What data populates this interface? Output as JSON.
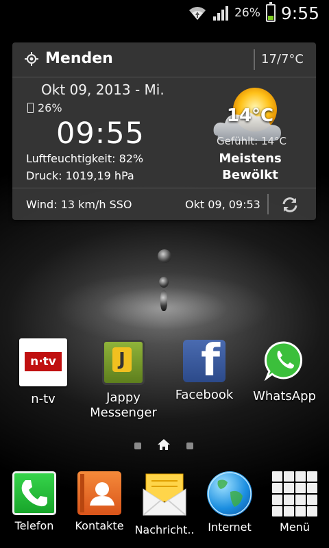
{
  "status_bar": {
    "battery_percent": "26%",
    "time": "9:55",
    "battery_level": 0.26,
    "icons": [
      "wifi-icon",
      "signal-icon",
      "battery-icon"
    ]
  },
  "weather_widget": {
    "city": "Menden",
    "high_low": "17/7°C",
    "date": "Okt 09, 2013 - Mi.",
    "battery": "26%",
    "time": "09:55",
    "humidity": "Luftfeuchtigkeit: 82%",
    "pressure": "Druck: 1019,19 hPa",
    "temperature": "14°C",
    "feels_like": "Gefühlt: 14°C",
    "condition_line1": "Meistens",
    "condition_line2": "Bewölkt",
    "wind": "Wind: 13 km/h SSO",
    "updated": "Okt 09, 09:53",
    "icons": [
      "location-icon",
      "partly-cloudy-icon",
      "refresh-icon"
    ]
  },
  "home_apps": [
    {
      "label": "n-tv",
      "icon": "ntv-icon",
      "icon_text": "n·tv"
    },
    {
      "label_line1": "Jappy",
      "label_line2": "Messenger",
      "icon": "jappy-icon",
      "icon_text": "J"
    },
    {
      "label": "Facebook",
      "icon": "facebook-icon",
      "icon_text": "f"
    },
    {
      "label": "WhatsApp",
      "icon": "whatsapp-icon"
    }
  ],
  "page_indicator": {
    "pages": 3,
    "current": 2
  },
  "dock": [
    {
      "label": "Telefon",
      "icon": "phone-icon"
    },
    {
      "label": "Kontakte",
      "icon": "contacts-icon"
    },
    {
      "label": "Nachricht..",
      "icon": "messages-icon"
    },
    {
      "label": "Internet",
      "icon": "internet-icon"
    },
    {
      "label": "Menü",
      "icon": "apps-menu-icon"
    }
  ]
}
